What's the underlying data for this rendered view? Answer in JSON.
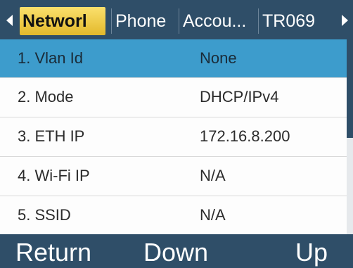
{
  "tabs": [
    {
      "label": "Networl",
      "active": true
    },
    {
      "label": "Phone",
      "active": false
    },
    {
      "label": "Accou...",
      "active": false
    },
    {
      "label": "TR069",
      "active": false
    }
  ],
  "icons": {
    "prev_tab": "triangle-left-icon",
    "next_tab": "triangle-right-icon"
  },
  "rows": [
    {
      "label": "1. Vlan Id",
      "value": "None",
      "selected": true
    },
    {
      "label": "2. Mode",
      "value": "DHCP/IPv4",
      "selected": false
    },
    {
      "label": "3. ETH IP",
      "value": "172.16.8.200",
      "selected": false
    },
    {
      "label": "4. Wi-Fi IP",
      "value": "N/A",
      "selected": false
    },
    {
      "label": "5. SSID",
      "value": "N/A",
      "selected": false
    }
  ],
  "softkeys": {
    "left": "Return",
    "middle": "Down",
    "right": "Up"
  },
  "scroll": {
    "position_fraction": 0.0,
    "visible_fraction": 0.5
  },
  "colors": {
    "header_bg": "#2f4e68",
    "active_tab": "#f2cf4a",
    "selected_row": "#3d9ccc"
  }
}
